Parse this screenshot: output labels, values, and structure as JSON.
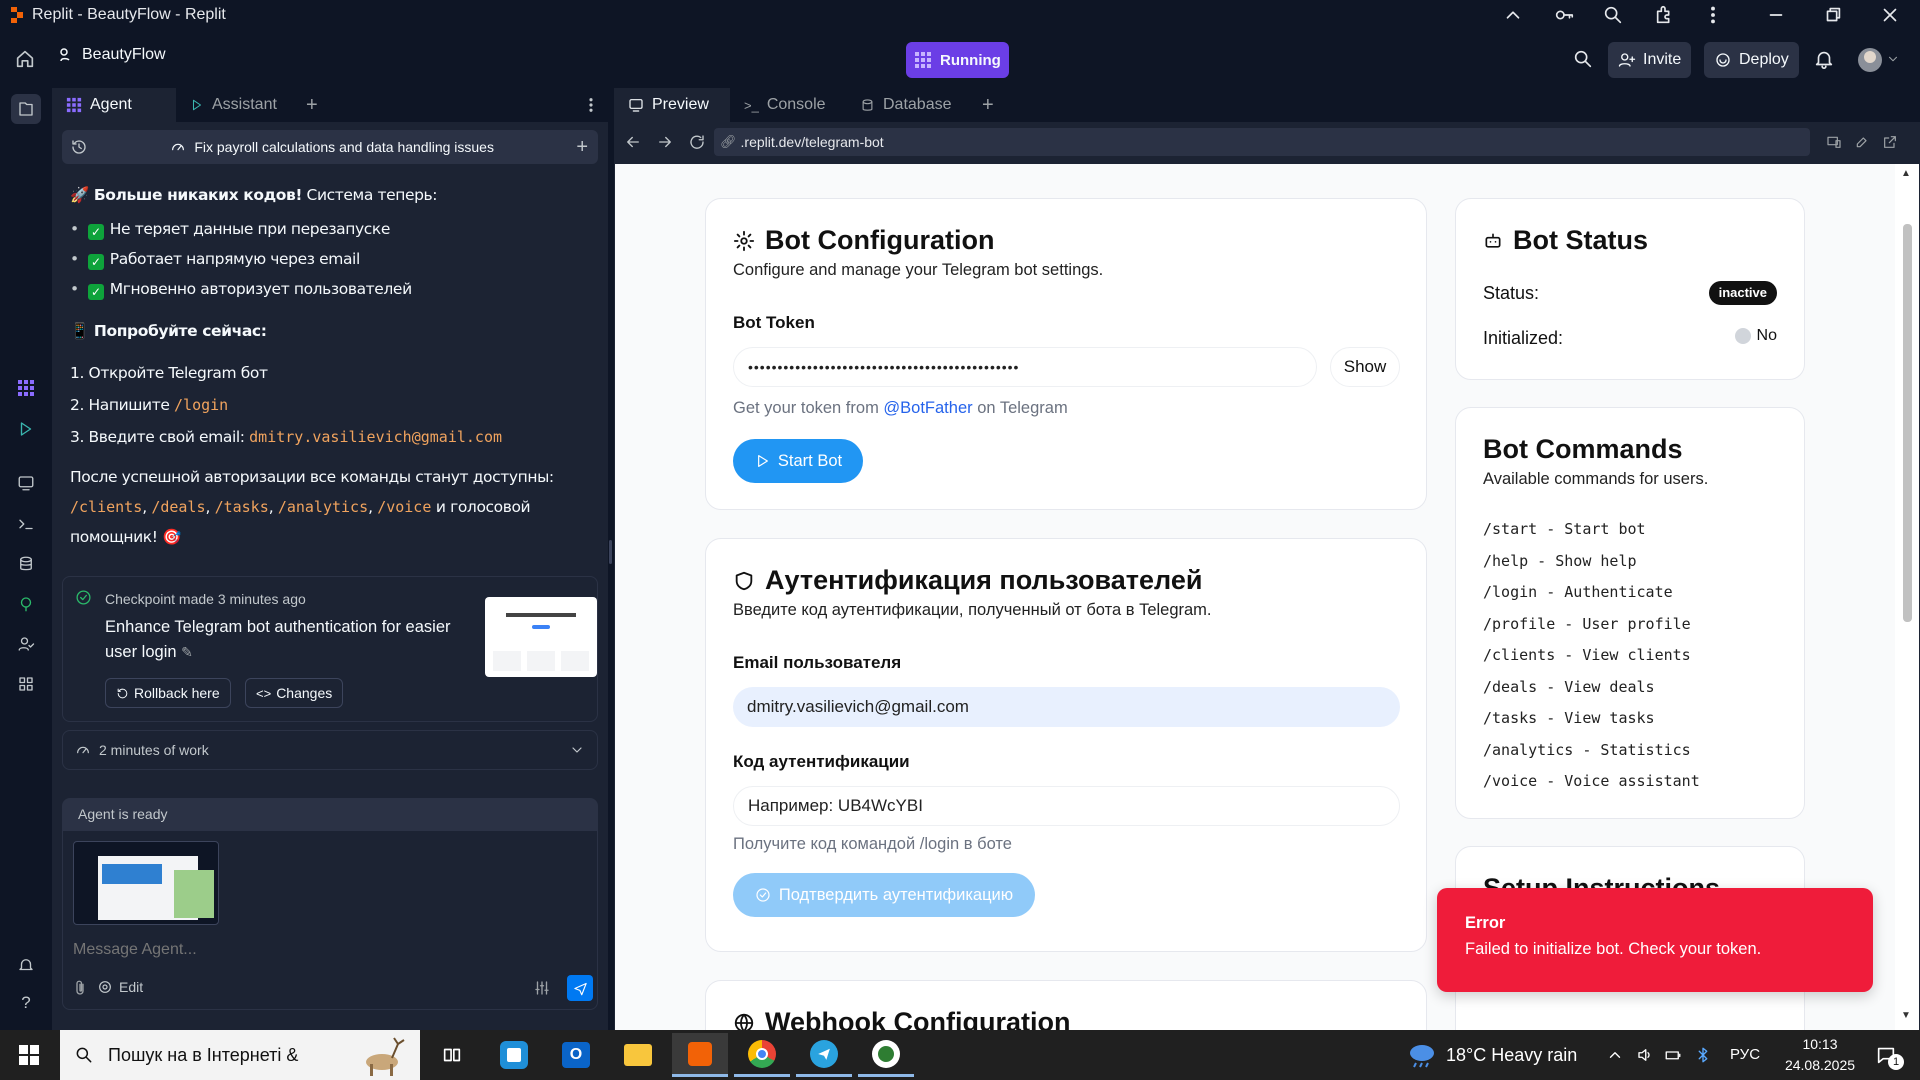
{
  "window": {
    "title": "Replit - BeautyFlow - Replit"
  },
  "header": {
    "project": "BeautyFlow",
    "run_status": "Running",
    "invite": "Invite",
    "deploy": "Deploy"
  },
  "left": {
    "tabs": [
      {
        "label": "Agent"
      },
      {
        "label": "Assistant"
      }
    ],
    "thread_title": "Fix payroll calculations and data handling issues",
    "msg": {
      "intro_bold": "🚀 Больше никаких кодов!",
      "intro_rest": " Система теперь:",
      "bullets": [
        "Не теряет данные при перезапуске",
        "Работает напрямую через email",
        "Мгновенно авторизует пользователей"
      ],
      "try_heading": "📱 Попробуйте сейчас:",
      "step1": "1. Откройте Telegram бот",
      "step2": "2. Напишите",
      "step2_code": "/login",
      "step3": "3. Введите свой email:",
      "step3_code": "dmitry.vasilievich@gmail.com",
      "after": "После успешной авторизации все команды станут доступны:",
      "cmds": [
        "/clients",
        "/deals",
        "/tasks",
        "/analytics",
        "/voice"
      ],
      "sep": ",",
      "after2": "и голосовой",
      "after3": "помощник! 🎯"
    },
    "checkpoint": {
      "meta": "Checkpoint made 3 minutes ago",
      "desc_line1": "Enhance Telegram bot authentication for easier",
      "desc_line2": "user login",
      "rollback": "Rollback here",
      "changes": "Changes"
    },
    "work": "2 minutes of work",
    "agent_status": "Agent is ready",
    "input": {
      "placeholder": "Message Agent...",
      "edit": "Edit"
    }
  },
  "right": {
    "tabs": [
      {
        "label": "Preview"
      },
      {
        "label": "Console"
      },
      {
        "label": "Database"
      }
    ],
    "url": ".replit.dev/telegram-bot",
    "config": {
      "title": "Bot Configuration",
      "subtitle": "Configure and manage your Telegram bot settings.",
      "token_label": "Bot Token",
      "token_value": "••••••••••••••••••••••••••••••••••••••••••••••",
      "show": "Show",
      "help_pre": "Get your token from",
      "help_link": "@BotFather",
      "help_post": "on Telegram",
      "start": "Start Bot"
    },
    "auth": {
      "title": "Аутентификация пользователей",
      "subtitle": "Введите код аутентификации, полученный от бота в Telegram.",
      "email_label": "Email пользователя",
      "email_value": "dmitry.vasilievich@gmail.com",
      "code_label": "Код аутентификации",
      "code_placeholder": "Например: UB4WcYBI",
      "hint": "Получите код командой /login в боте",
      "confirm": "Подтвердить аутентификацию"
    },
    "webhook": {
      "title": "Webhook Configuration"
    },
    "status": {
      "title": "Bot Status",
      "status_label": "Status:",
      "status_value": "inactive",
      "init_label": "Initialized:",
      "init_value": "No"
    },
    "commands": {
      "title": "Bot Commands",
      "subtitle": "Available commands for users.",
      "items": [
        "/start - Start bot",
        "/help - Show help",
        "/login - Authenticate",
        "/profile - User profile",
        "/clients - View clients",
        "/deals - View deals",
        "/tasks - View tasks",
        "/analytics - Statistics",
        "/voice - Voice assistant"
      ]
    },
    "setup": {
      "title": "Setup Instructions"
    },
    "toast": {
      "title": "Error",
      "message": "Failed to initialize bot. Check your token."
    }
  },
  "taskbar": {
    "search": "Пошук на в Інтернеті &",
    "weather": "18°C  Heavy rain",
    "lang": "РУС",
    "time": "10:13",
    "date": "24.08.2025",
    "notif_count": "1"
  },
  "colors": {
    "accent": "#0079f2",
    "running": "#7c3aed",
    "error": "#ef1c3a",
    "bg": "#0e1525",
    "panel": "#1c2333"
  }
}
